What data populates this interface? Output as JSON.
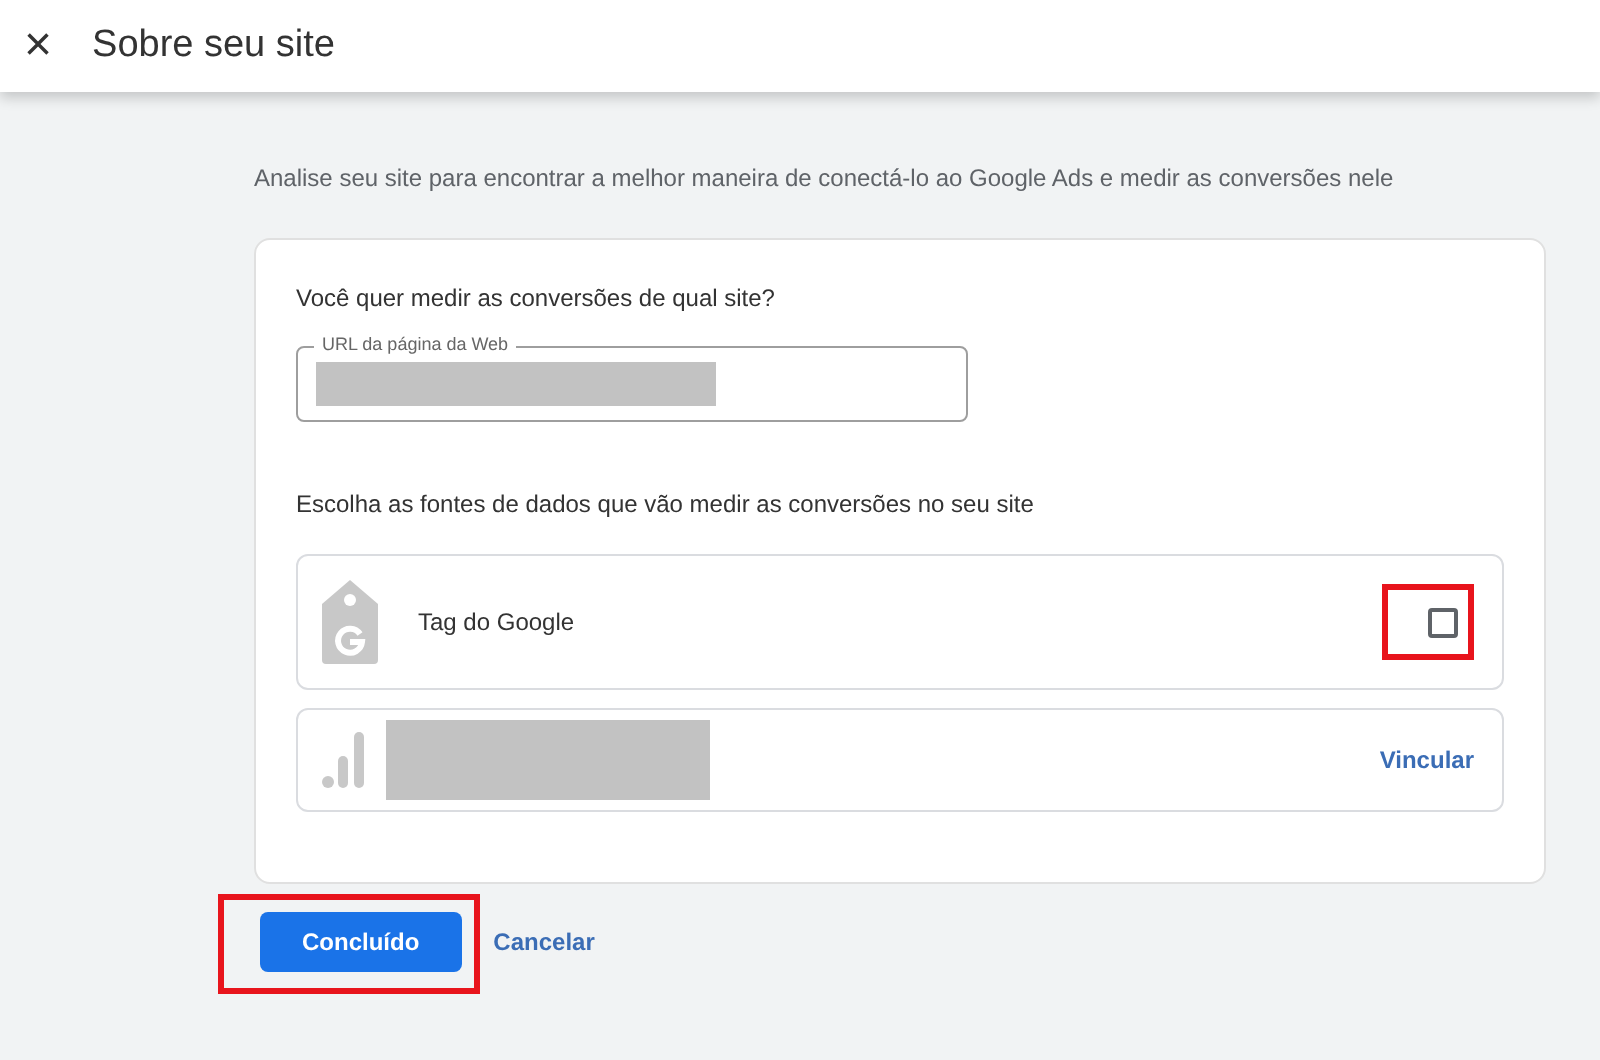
{
  "header": {
    "close": "×",
    "title": "Sobre seu site"
  },
  "intro": "Analise seu site para encontrar a melhor maneira de conectá-lo ao Google Ads e medir as conversões nele",
  "card": {
    "question": "Você quer medir as conversões de qual site?",
    "url_field": {
      "label": "URL da página da Web",
      "redacted": true
    },
    "sources_heading": "Escolha as fontes de dados que vão medir as conversões no seu site",
    "sources": [
      {
        "kind": "checkbox",
        "label": "Tag do Google",
        "checked": false,
        "highlighted": true
      },
      {
        "kind": "link",
        "redacted": true,
        "action": "Vincular"
      }
    ]
  },
  "buttons": [
    {
      "kind": "primary",
      "label": "Concluído",
      "highlighted": true
    },
    {
      "kind": "text",
      "label": "Cancelar"
    }
  ]
}
